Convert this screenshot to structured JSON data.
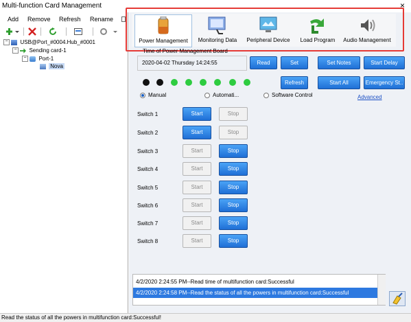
{
  "window": {
    "title": "Multi-function Card Management",
    "close_glyph": "×"
  },
  "menu": {
    "add": "Add",
    "remove": "Remove",
    "refresh": "Refresh",
    "rename": "Rename"
  },
  "tree": {
    "root": "USB@Port_#0004.Hub_#0001",
    "sending_card": "Sending card-1",
    "port": "Port-1",
    "device": "Nova"
  },
  "ribbon": {
    "items": [
      {
        "label": "Power Management",
        "icon": "battery-icon",
        "selected": true
      },
      {
        "label": "Monitoring Data",
        "icon": "monitor-icon",
        "selected": false
      },
      {
        "label": "Peripheral Device",
        "icon": "peripheral-monitor-icon",
        "selected": false
      },
      {
        "label": "Load Program",
        "icon": "load-arrow-icon",
        "selected": false
      },
      {
        "label": "Audio Management",
        "icon": "speaker-icon",
        "selected": false
      }
    ]
  },
  "power": {
    "section_title": "Time of Power Management Board",
    "datetime": "2020-04-02 Thursday 14:24:55",
    "read": "Read",
    "set": "Set",
    "set_notes": "Set Notes",
    "start_delay": "Start Delay",
    "refresh": "Refresh",
    "start_all": "Start All",
    "emergency": "Emergency St..",
    "advanced": "Advanced",
    "modes": {
      "manual": "Manual",
      "automatic": "Automati...",
      "software": "Software Control",
      "selected": "manual"
    },
    "indicators": [
      "off",
      "off",
      "on",
      "on",
      "on",
      "on",
      "on",
      "on"
    ],
    "colors": {
      "on": "#2ecc40",
      "off": "#111111",
      "accent": "#1f6fd6",
      "highlight_border": "#e53935"
    },
    "switches": [
      {
        "label": "Switch 1",
        "start": "Start",
        "stop": "Stop",
        "state": "on"
      },
      {
        "label": "Switch 2",
        "start": "Start",
        "stop": "Stop",
        "state": "on"
      },
      {
        "label": "Switch 3",
        "start": "Start",
        "stop": "Stop",
        "state": "off"
      },
      {
        "label": "Switch 4",
        "start": "Start",
        "stop": "Stop",
        "state": "off"
      },
      {
        "label": "Switch 5",
        "start": "Start",
        "stop": "Stop",
        "state": "off"
      },
      {
        "label": "Switch 6",
        "start": "Start",
        "stop": "Stop",
        "state": "off"
      },
      {
        "label": "Switch 7",
        "start": "Start",
        "stop": "Stop",
        "state": "off"
      },
      {
        "label": "Switch 8",
        "start": "Start",
        "stop": "Stop",
        "state": "off"
      }
    ]
  },
  "log": {
    "lines": [
      "4/2/2020 2:24:55 PM--Read time of multifunction card:Successful",
      "4/2/2020 2:24:58 PM--Read the status of all the powers in multifunction card:Successful"
    ],
    "selected_index": 1
  },
  "status": "Read the status of all the powers in multifunction card:Successful!"
}
